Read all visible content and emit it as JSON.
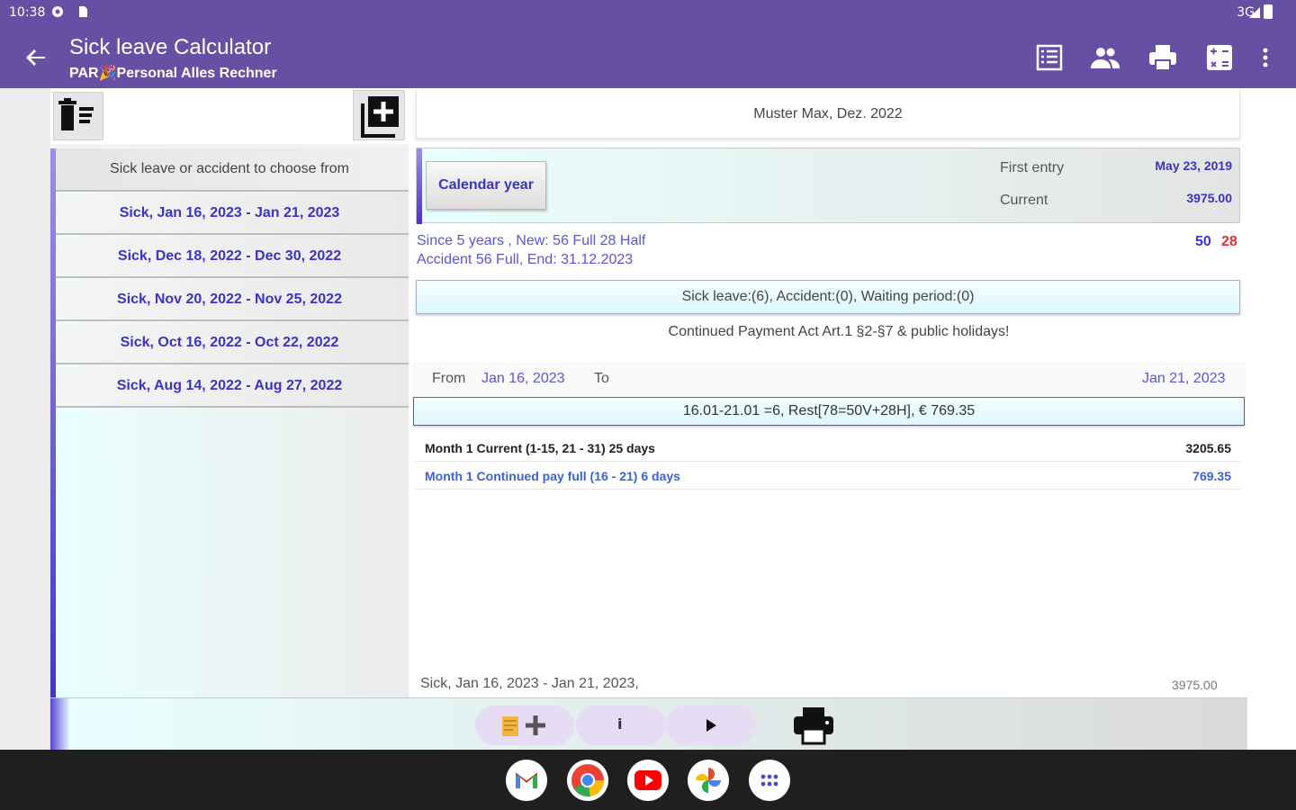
{
  "status_bar": {
    "time": "10:38",
    "network": "3G"
  },
  "app_bar": {
    "title": "Sick leave Calculator",
    "subtitle": "PAR🎉Personal Alles Rechner",
    "actions": [
      "list-icon",
      "people-icon",
      "print-icon",
      "calculator-icon",
      "more-vert-icon"
    ]
  },
  "left": {
    "header": "Sick leave or accident to choose from",
    "items": [
      "Sick, Jan 16, 2023 - Jan 21, 2023",
      "Sick, Dec 18, 2022 - Dec 30, 2022",
      "Sick, Nov 20, 2022 - Nov 25, 2022",
      "Sick, Oct 16, 2022 - Oct 22, 2022",
      "Sick, Aug 14, 2022 - Aug 27, 2022"
    ]
  },
  "right": {
    "person": "Muster Max, Dez. 2022",
    "calendar_button": "Calendar year",
    "first_entry_label": "First entry",
    "first_entry_value": "May 23, 2019",
    "current_label": "Current",
    "current_value": "3975.00",
    "info_line1": "Since  5 years , New: 56 Full 28 Half",
    "info_line2": "Accident 56 Full, End: 31.12.2023",
    "days_full": "50",
    "days_half": "28",
    "counts": "Sick leave:(6), Accident:(0), Waiting period:(0)",
    "law": "Continued Payment Act Art.1 §2-§7 & public holidays!",
    "from_label": "From",
    "from_value": "Jan 16, 2023",
    "to_label": "To",
    "to_value": "Jan 21, 2023",
    "calc": "16.01-21.01 =6, Rest[78=50V+28H], €   769.35",
    "months": [
      {
        "label": "Month 1 Current (1-15, 21 - 31) 25 days",
        "value": "3205.65",
        "color": "#222222"
      },
      {
        "label": "Month 1 Continued pay full (16 - 21) 6 days",
        "value": "769.35",
        "color": "#3b63d6"
      }
    ],
    "footer_label": "Sick, Jan 16, 2023 - Jan 21, 2023,",
    "footer_value": "3975.00"
  },
  "bottom_bar": {
    "info_label": "i"
  },
  "dock": [
    "gmail-icon",
    "chrome-icon",
    "youtube-icon",
    "photos-icon",
    "apps-icon"
  ],
  "colors": {
    "primary": "#6750a4",
    "accent_text": "#3b33c4",
    "half_days": "#e0303a"
  }
}
